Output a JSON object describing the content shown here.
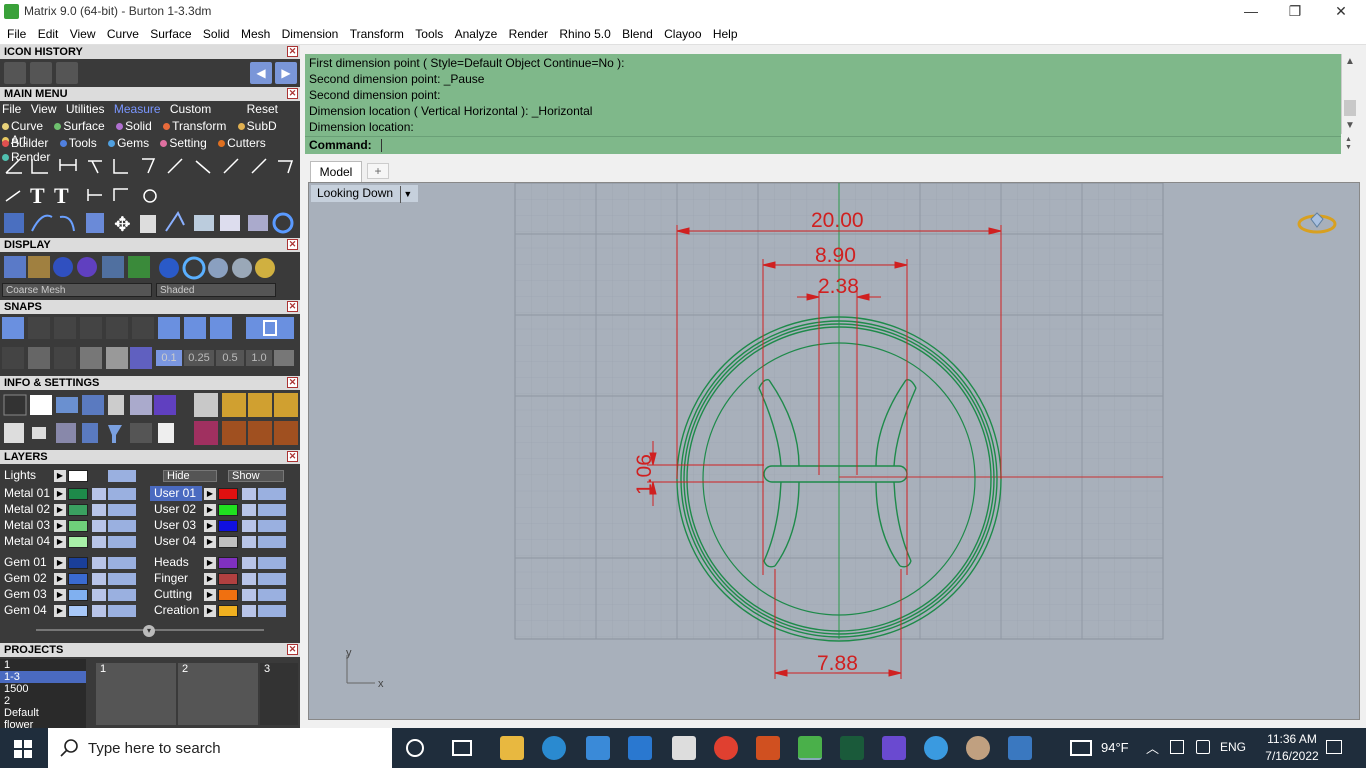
{
  "window": {
    "title": "Matrix 9.0 (64-bit) - Burton 1-3.3dm",
    "minimize": "—",
    "restore": "❐",
    "close": "✕"
  },
  "menubar": [
    "File",
    "Edit",
    "View",
    "Curve",
    "Surface",
    "Solid",
    "Mesh",
    "Dimension",
    "Transform",
    "Tools",
    "Analyze",
    "Render",
    "Rhino 5.0",
    "Blend",
    "Clayoo",
    "Help"
  ],
  "panels": {
    "icon_history": "ICON HISTORY",
    "main_menu": "MAIN MENU",
    "display": "DISPLAY",
    "snaps": "SNAPS",
    "info_settings": "INFO & SETTINGS",
    "layers": "LAYERS",
    "projects": "PROJECTS"
  },
  "main_menu": {
    "tabs": [
      "File",
      "View",
      "Utilities",
      "Measure",
      "Custom"
    ],
    "active_tab": "Measure",
    "reset": "Reset",
    "row1": [
      {
        "label": "Curve",
        "color": "#e8d27a"
      },
      {
        "label": "Surface",
        "color": "#6ec06e"
      },
      {
        "label": "Solid",
        "color": "#b070d0"
      },
      {
        "label": "Transform",
        "color": "#e86a3a"
      },
      {
        "label": "SubD",
        "color": "#e0b050"
      },
      {
        "label": "Art",
        "color": "#e8c860"
      }
    ],
    "row2": [
      {
        "label": "Builder",
        "color": "#e05050"
      },
      {
        "label": "Tools",
        "color": "#5080e0"
      },
      {
        "label": "Gems",
        "color": "#50a0e0"
      },
      {
        "label": "Setting",
        "color": "#e070a0"
      },
      {
        "label": "Cutters",
        "color": "#e07020"
      },
      {
        "label": "Render",
        "color": "#50c0b0"
      }
    ]
  },
  "display": {
    "mesh_select": "Coarse Mesh",
    "shade_select": "Shaded"
  },
  "snaps": {
    "values": [
      "0.1",
      "0.25",
      "0.5",
      "1.0"
    ]
  },
  "layers": {
    "lights": "Lights",
    "hide": "Hide",
    "show": "Show",
    "left_col": [
      {
        "name": "Metal 01",
        "color": "#1e8a4a"
      },
      {
        "name": "Metal 02",
        "color": "#3aa060"
      },
      {
        "name": "Metal 03",
        "color": "#6fd07a"
      },
      {
        "name": "Metal 04",
        "color": "#a8f0a8"
      },
      {
        "name": "Gem 01",
        "color": "#1a3f9a"
      },
      {
        "name": "Gem 02",
        "color": "#3a6ad0"
      },
      {
        "name": "Gem 03",
        "color": "#80b0f0"
      },
      {
        "name": "Gem 04",
        "color": "#a8c8f8"
      }
    ],
    "right_col": [
      {
        "name": "User 01",
        "color": "#e01010",
        "selected": true
      },
      {
        "name": "User 02",
        "color": "#20e020"
      },
      {
        "name": "User 03",
        "color": "#1010e0"
      },
      {
        "name": "User 04",
        "color": "#c0c0c0"
      },
      {
        "name": "Heads",
        "color": "#8030c0"
      },
      {
        "name": "Finger",
        "color": "#b04040"
      },
      {
        "name": "Cutting",
        "color": "#f07010"
      },
      {
        "name": "Creation",
        "color": "#f0b020"
      }
    ]
  },
  "projects": {
    "list": [
      "1",
      "1-3",
      "1500",
      "2",
      "Default",
      "flower"
    ],
    "selected": "1-3",
    "thumbs": [
      "1",
      "2",
      "3"
    ]
  },
  "command": {
    "lines": [
      "First dimension point ( Style=Default  Object  Continue=No ):",
      "Second dimension point: _Pause",
      "Second dimension point:",
      "Dimension location ( Vertical  Horizontal ): _Horizontal",
      "Dimension location:"
    ],
    "prompt": "Command:"
  },
  "viewport": {
    "tab": "Model",
    "add_tab": "+",
    "view_name": "Looking Down",
    "dims": {
      "d1": "20.00",
      "d2": "8.90",
      "d3": "2.38",
      "d4": "1.06",
      "d5": "7.88"
    },
    "axis_y": "y",
    "axis_x": "x"
  },
  "taskbar": {
    "search_placeholder": "Type here to search",
    "weather": "94°F",
    "lang": "ENG",
    "time": "11:36 AM",
    "date": "7/16/2022"
  }
}
